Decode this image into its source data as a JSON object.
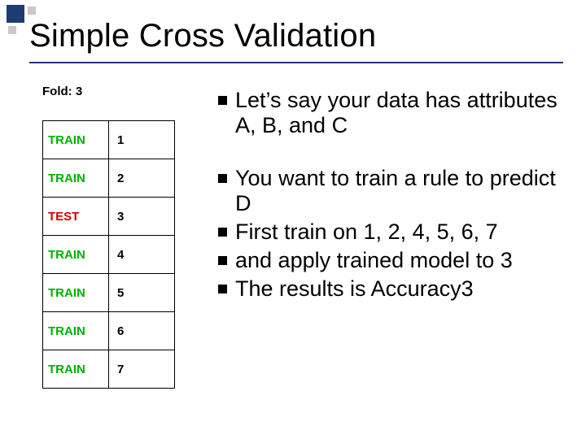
{
  "title": "Simple Cross Validation",
  "fold_label": "Fold: 3",
  "table": {
    "rows": [
      {
        "role": "TRAIN",
        "kind": "train",
        "num": "1"
      },
      {
        "role": "TRAIN",
        "kind": "train",
        "num": "2"
      },
      {
        "role": "TEST",
        "kind": "test",
        "num": "3"
      },
      {
        "role": "TRAIN",
        "kind": "train",
        "num": "4"
      },
      {
        "role": "TRAIN",
        "kind": "train",
        "num": "5"
      },
      {
        "role": "TRAIN",
        "kind": "train",
        "num": "6"
      },
      {
        "role": "TRAIN",
        "kind": "train",
        "num": "7"
      }
    ]
  },
  "bullets": {
    "b1": "Let’s say your data has attributes A, B, and C",
    "b2": "You want to train a rule to predict D",
    "b3": "First train on 1, 2, 4, 5, 6, 7",
    "b4": "and apply trained model to 3",
    "b5": "The results is Accuracy3"
  }
}
